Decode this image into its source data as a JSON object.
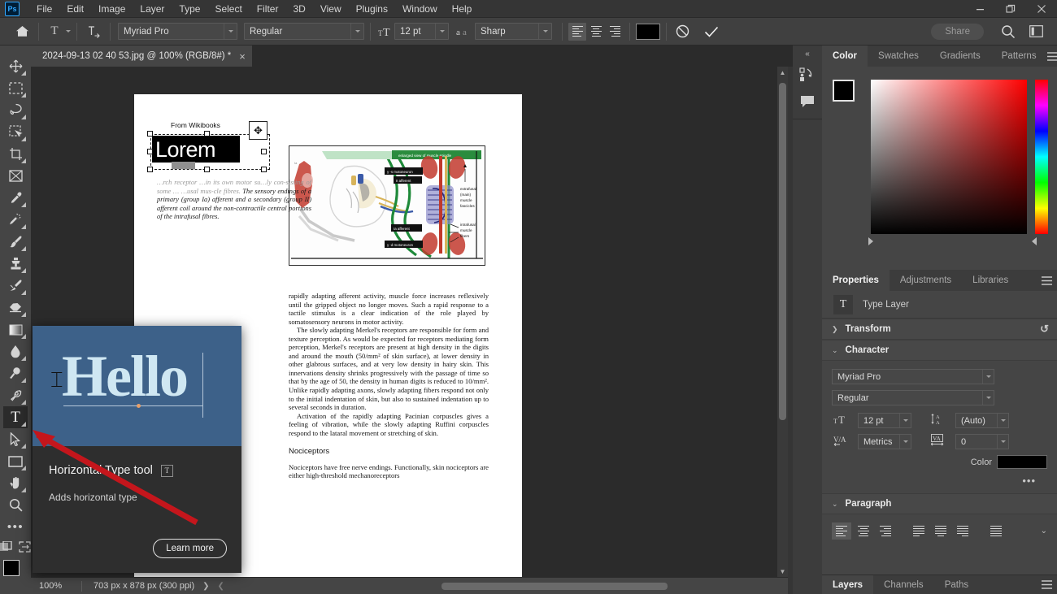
{
  "app": {
    "name": "Adobe Photoshop",
    "logo_text": "Ps",
    "menu": [
      "File",
      "Edit",
      "Image",
      "Layer",
      "Type",
      "Select",
      "Filter",
      "3D",
      "View",
      "Plugins",
      "Window",
      "Help"
    ],
    "window_controls": [
      "minimize",
      "restore",
      "close"
    ]
  },
  "options_bar": {
    "home_icon": "home-icon",
    "tool_preset_icon": "type-tool-icon",
    "orientation_icon": "toggle-text-orientation-icon",
    "font_family": "Myriad Pro",
    "font_style": "Regular",
    "font_size_icon": "font-size-icon",
    "font_size": "12 pt",
    "antialias_icon": "anti-aliasing-icon",
    "antialias": "Sharp",
    "align": [
      "align-left",
      "align-center",
      "align-right"
    ],
    "align_active": "align-left",
    "text_color": "#000000",
    "cancel_icon": "cancel-icon",
    "commit_icon": "commit-checkmark-icon",
    "share_label": "Share",
    "search_icon": "search-icon",
    "workspace_icon": "workspace-panels-icon"
  },
  "document_tab": {
    "title": "2024-09-13 02 40 53.jpg @ 100% (RGB/8#) *",
    "close_icon": "close-icon"
  },
  "toolbar": {
    "collapse_icon": "expand-toolbar-icon",
    "tools": [
      {
        "name": "move-tool",
        "glyph": "✥",
        "group": true,
        "active": false
      },
      {
        "name": "rectangular-marquee-tool",
        "glyph": "▭",
        "group": true,
        "active": false
      },
      {
        "name": "lasso-tool",
        "glyph": "◯",
        "group": true,
        "active": false
      },
      {
        "name": "object-selection-tool",
        "glyph": "▨",
        "group": true,
        "active": false
      },
      {
        "name": "crop-tool",
        "glyph": "⌗",
        "group": true,
        "active": false
      },
      {
        "name": "frame-tool",
        "glyph": "⊠",
        "group": false,
        "active": false
      },
      {
        "name": "eyedropper-tool",
        "glyph": "✒",
        "group": true,
        "active": false
      },
      {
        "name": "spot-healing-brush-tool",
        "glyph": "✎",
        "group": true,
        "active": false
      },
      {
        "name": "brush-tool",
        "glyph": "🖌",
        "group": true,
        "active": false
      },
      {
        "name": "clone-stamp-tool",
        "glyph": "⛉",
        "group": true,
        "active": false
      },
      {
        "name": "history-brush-tool",
        "glyph": "🖉",
        "group": true,
        "active": false
      },
      {
        "name": "eraser-tool",
        "glyph": "▰",
        "group": true,
        "active": false
      },
      {
        "name": "gradient-tool",
        "glyph": "▤",
        "group": true,
        "active": false
      },
      {
        "name": "blur-tool",
        "glyph": "💧",
        "group": true,
        "active": false
      },
      {
        "name": "dodge-tool",
        "glyph": "🔍",
        "group": true,
        "active": false
      },
      {
        "name": "pen-tool",
        "glyph": "✐",
        "group": true,
        "active": false
      },
      {
        "name": "horizontal-type-tool",
        "glyph": "T",
        "group": true,
        "active": true
      },
      {
        "name": "path-selection-tool",
        "glyph": "➤",
        "group": true,
        "active": false
      },
      {
        "name": "rectangle-tool",
        "glyph": "▭",
        "group": true,
        "active": false
      },
      {
        "name": "hand-tool",
        "glyph": "✋",
        "group": true,
        "active": false
      },
      {
        "name": "zoom-tool",
        "glyph": "🔎",
        "group": false,
        "active": false
      },
      {
        "name": "edit-toolbar-tool",
        "glyph": "•••",
        "group": false,
        "active": false
      }
    ],
    "quick_mask_icon": "quick-mask-icon",
    "screen_mode_icon": "screen-mode-icon",
    "foreground_color": "#000000",
    "background_color": "#ffffff"
  },
  "tooltip": {
    "title": "Horizontal Type tool",
    "shortcut": "T",
    "description": "Adds horizontal type",
    "learn_more": "Learn more",
    "hero_word": "Hello",
    "hero_bg": "#3d6189",
    "hero_text_color": "#cfe7f2"
  },
  "canvas": {
    "selected_text_layer": "Lorem",
    "page_heading": "From Wikibooks",
    "left_column": "…rch receptor\n…in its own motor su…ly con-\nsisting of some … …usal mus-\ncle fibres. The sensory endings of a primary (group Ia) afferent and a secondary (group II) afferent coil around the non-contractile central portions of the intrafusal fibres.",
    "diagram": {
      "name": "muscle-spindle-diagram",
      "labels": [
        "enlarged view of muscle spindle",
        "γ -s motoneuron",
        "II afferent",
        "Ia afferent",
        "γ -d motoneuron",
        "extrafusal (main) muscle fascicles",
        "intrafusal muscle fibers"
      ]
    },
    "right_column_paragraphs": [
      "rapidly adapting afferent activity, muscle force increases reflexively until the gripped object no longer moves. Such a rapid response to a tactile stimulus is a clear indication of the role played by somatosensory neurons in motor activity.",
      "The slowly adapting Merkel's receptors are responsible for form and texture perception. As would be expected for receptors mediating form perception, Merkel's receptors are present at high density in the digits and around the mouth (50/mm² of skin surface), at lower density in other glabrous surfaces, and at very low density in hairy skin. This innervations density shrinks progressively with the passage of time so that by the age of 50, the density in human digits is reduced to 10/mm². Unlike rapidly adapting axons, slowly adapting fibers respond not only to the initial indentation of skin, but also to sustained indentation up to several seconds in duration.",
      "Activation of the rapidly adapting Pacinian corpuscles gives a feeling of vibration, while the slowly adapting Ruffini corpuscles respond to the lataral movement or stretching of skin."
    ],
    "section_heading": "Nociceptors",
    "section_paragraph": "Nociceptors have free nerve endings. Functionally, skin nociceptors are either high-threshold mechanoreceptors"
  },
  "status_bar": {
    "zoom": "100%",
    "dimensions": "703 px x 878 px (300 ppi)",
    "expand_icon": "chevron-right-icon",
    "collapse_icon": "chevron-left-icon"
  },
  "dock_strip": {
    "collapse_icon": "collapse-panels-icon",
    "icons": [
      "libraries-icon",
      "comments-icon"
    ]
  },
  "color_panel": {
    "tabs": [
      "Color",
      "Swatches",
      "Gradients",
      "Patterns"
    ],
    "active_tab": "Color",
    "menu_icon": "panel-menu-icon",
    "foreground": "#000000",
    "background": "#ffffff",
    "ramp": "red-spectrum"
  },
  "properties_panel": {
    "tabs": [
      "Properties",
      "Adjustments",
      "Libraries"
    ],
    "active_tab": "Properties",
    "menu_icon": "panel-menu-icon",
    "layer_type_icon": "type-layer-icon",
    "layer_type_label": "Type Layer",
    "sections": {
      "transform": {
        "label": "Transform",
        "expanded": false,
        "reset_icon": "reset-icon"
      },
      "character": {
        "label": "Character",
        "expanded": true
      },
      "paragraph": {
        "label": "Paragraph",
        "expanded": true
      }
    },
    "character": {
      "font_family": "Myriad Pro",
      "font_style": "Regular",
      "size_icon": "font-size-icon",
      "size": "12 pt",
      "leading_icon": "leading-icon",
      "leading": "(Auto)",
      "kerning_icon": "kerning-icon",
      "kerning": "Metrics",
      "tracking_icon": "tracking-icon",
      "tracking": "0",
      "color_label": "Color",
      "color_value": "#000000",
      "more_icon": "more-options-icon"
    },
    "paragraph": {
      "align_buttons": [
        "align-left",
        "align-center",
        "align-right"
      ],
      "justify_buttons": [
        "justify-last-left",
        "justify-last-center",
        "justify-last-right",
        "justify-all"
      ],
      "active": "align-left"
    }
  },
  "layers_panel": {
    "tabs": [
      "Layers",
      "Channels",
      "Paths"
    ],
    "active_tab": "Layers",
    "menu_icon": "panel-menu-icon"
  },
  "colors": {
    "chrome_dark": "#2b2b2b",
    "chrome_mid": "#353535",
    "panel": "#454545",
    "options_bar": "#404040",
    "accent_blue": "#31a8ff",
    "annotation_red": "#c4161c"
  }
}
